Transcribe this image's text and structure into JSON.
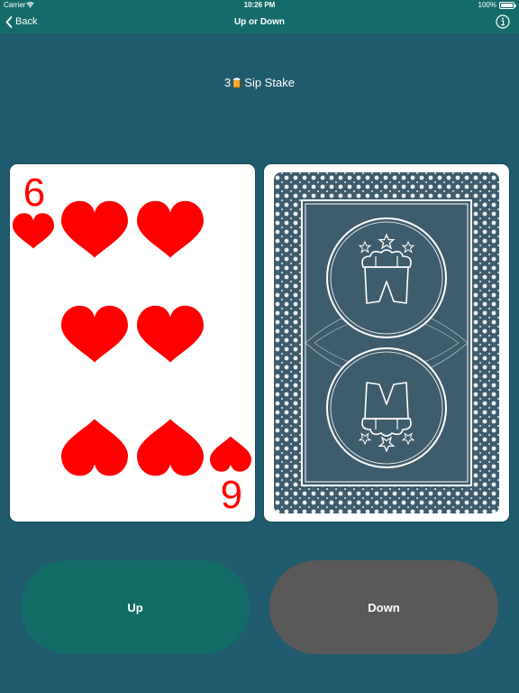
{
  "status": {
    "carrier": "Carrier",
    "time": "10:26 PM",
    "battery": "100%"
  },
  "nav": {
    "back_label": "Back",
    "title": "Up or Down"
  },
  "stake": {
    "count": "3",
    "label": "Sip Stake"
  },
  "card_face": {
    "rank": "6",
    "suit": "hearts",
    "suit_color": "#ff0000",
    "icon": "heart-icon"
  },
  "card_back": {
    "color": "#3d5c6d",
    "icon": "lederhosen-icon"
  },
  "buttons": {
    "up_label": "Up",
    "down_label": "Down"
  },
  "colors": {
    "background": "#1f5a6e",
    "bar": "#156b6b",
    "up": "#136b68",
    "down": "#595959"
  }
}
